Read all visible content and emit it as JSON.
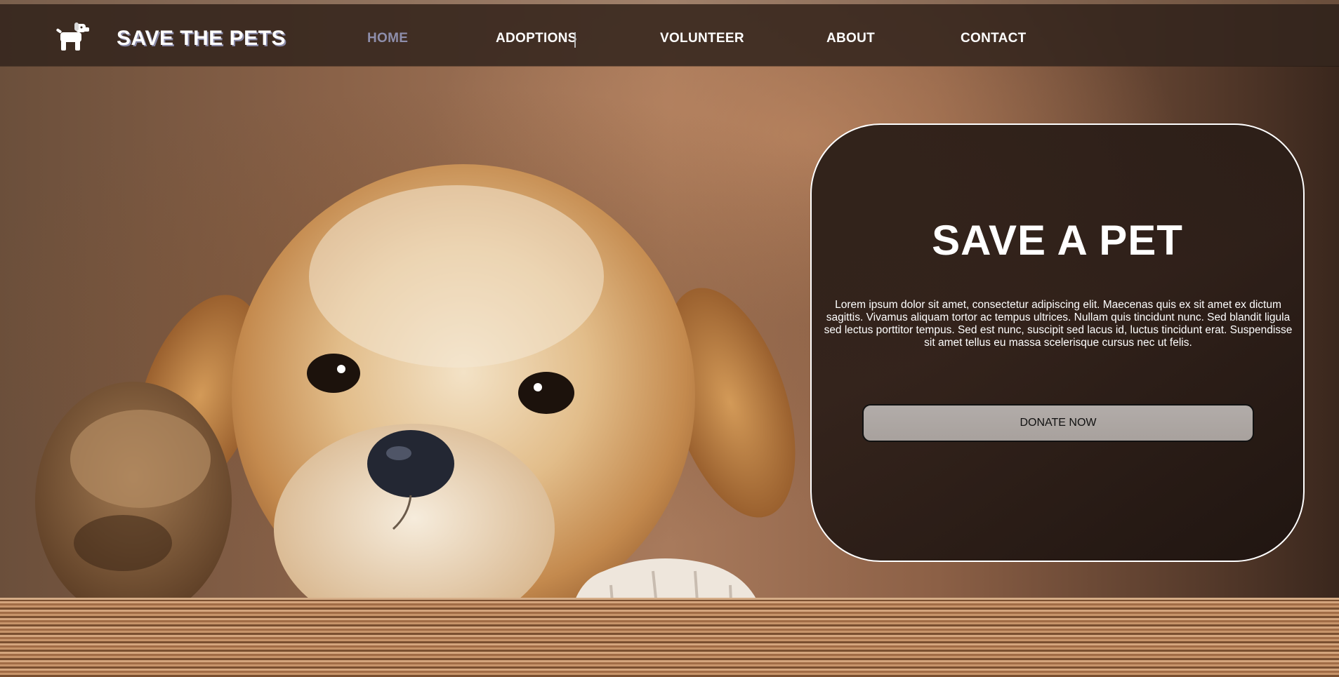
{
  "header": {
    "brand": "SAVE THE PETS",
    "logo_icon": "dog-icon",
    "nav": [
      {
        "label": "HOME",
        "active": true
      },
      {
        "label": "ADOPTIONS",
        "active": false
      },
      {
        "label": "VOLUNTEER",
        "active": false
      },
      {
        "label": "ABOUT",
        "active": false
      },
      {
        "label": "CONTACT",
        "active": false
      }
    ]
  },
  "hero": {
    "image": "puppy-photo",
    "card": {
      "title": "SAVE A PET",
      "text": "Lorem ipsum dolor sit amet, consectetur adipiscing elit. Maecenas quis ex sit amet ex dictum sagittis. Vivamus aliquam tortor ac tempus ultrices. Nullam quis tincidunt nunc. Sed blandit ligula sed lectus porttitor tempus. Sed est nunc, suscipit sed lacus id, luctus tincidunt erat. Suspendisse sit amet tellus eu massa scelerisque cursus nec ut felis.",
      "button_label": "DONATE NOW"
    }
  },
  "colors": {
    "nav_background": "#34261e",
    "active_link": "#8e8eab",
    "button_background": "#aea8a5",
    "card_border": "#ffffff"
  }
}
